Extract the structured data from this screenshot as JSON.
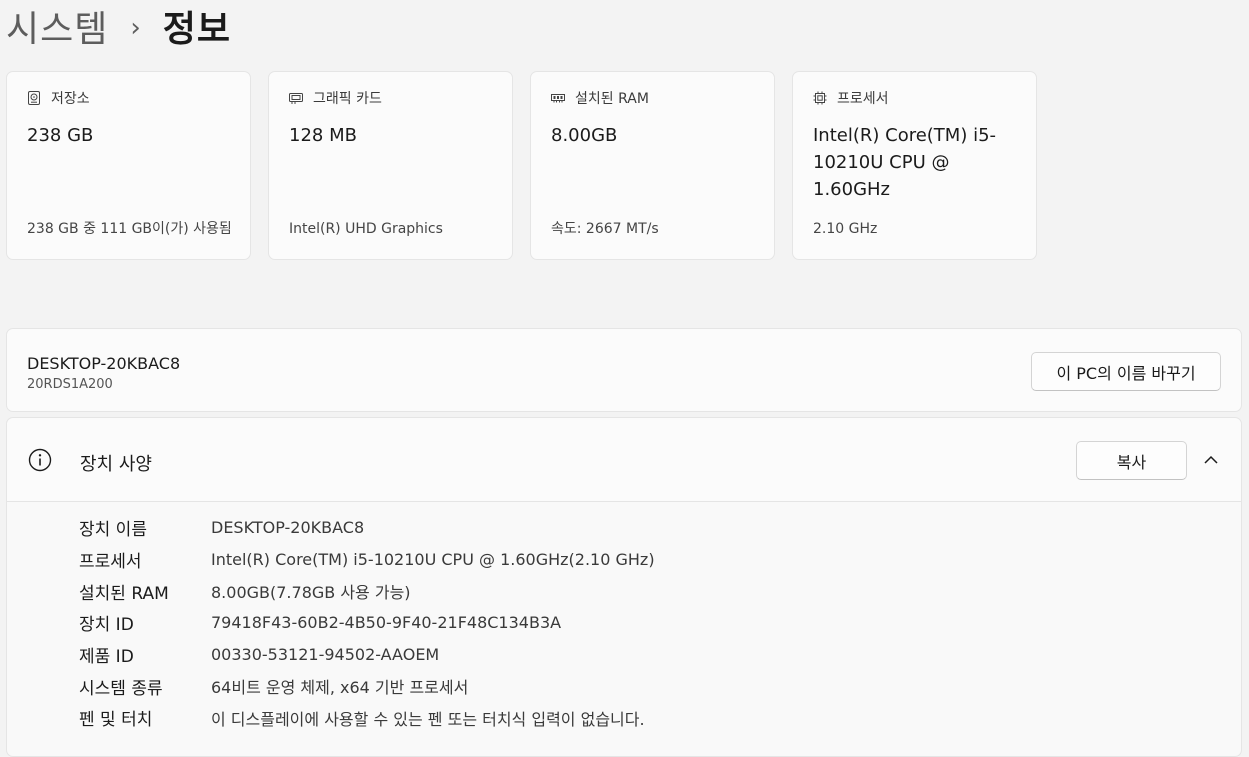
{
  "breadcrumb": {
    "parent": "시스템",
    "separator": "›",
    "current": "정보"
  },
  "cards": [
    {
      "title": "저장소",
      "icon": "storage-drive-icon",
      "value": "238 GB",
      "sub": "238 GB 중 111 GB이(가) 사용됨"
    },
    {
      "title": "그래픽 카드",
      "icon": "graphics-card-icon",
      "value": "128 MB",
      "sub": "Intel(R) UHD Graphics"
    },
    {
      "title": "설치된 RAM",
      "icon": "ram-icon",
      "value": "8.00GB",
      "sub": "속도: 2667 MT/s"
    },
    {
      "title": "프로세서",
      "icon": "processor-icon",
      "value": "Intel(R) Core(TM) i5-10210U CPU @ 1.60GHz",
      "sub": "2.10 GHz"
    }
  ],
  "device": {
    "name": "DESKTOP-20KBAC8",
    "model": "20RDS1A200",
    "rename_label": "이 PC의 이름 바꾸기"
  },
  "specs": {
    "title": "장치 사양",
    "copy_label": "복사",
    "icon": "info-icon",
    "rows": [
      {
        "label": "장치 이름",
        "value": "DESKTOP-20KBAC8"
      },
      {
        "label": "프로세서",
        "value": "Intel(R) Core(TM) i5-10210U CPU @ 1.60GHz(2.10 GHz)"
      },
      {
        "label": "설치된 RAM",
        "value": "8.00GB(7.78GB 사용 가능)"
      },
      {
        "label": "장치 ID",
        "value": "79418F43-60B2-4B50-9F40-21F48C134B3A"
      },
      {
        "label": "제품 ID",
        "value": "00330-53121-94502-AAOEM"
      },
      {
        "label": "시스템 종류",
        "value": "64비트 운영 체제, x64 기반 프로세서"
      },
      {
        "label": "펜 및 터치",
        "value": "이 디스플레이에 사용할 수 있는 펜 또는 터치식 입력이 없습니다."
      }
    ]
  }
}
